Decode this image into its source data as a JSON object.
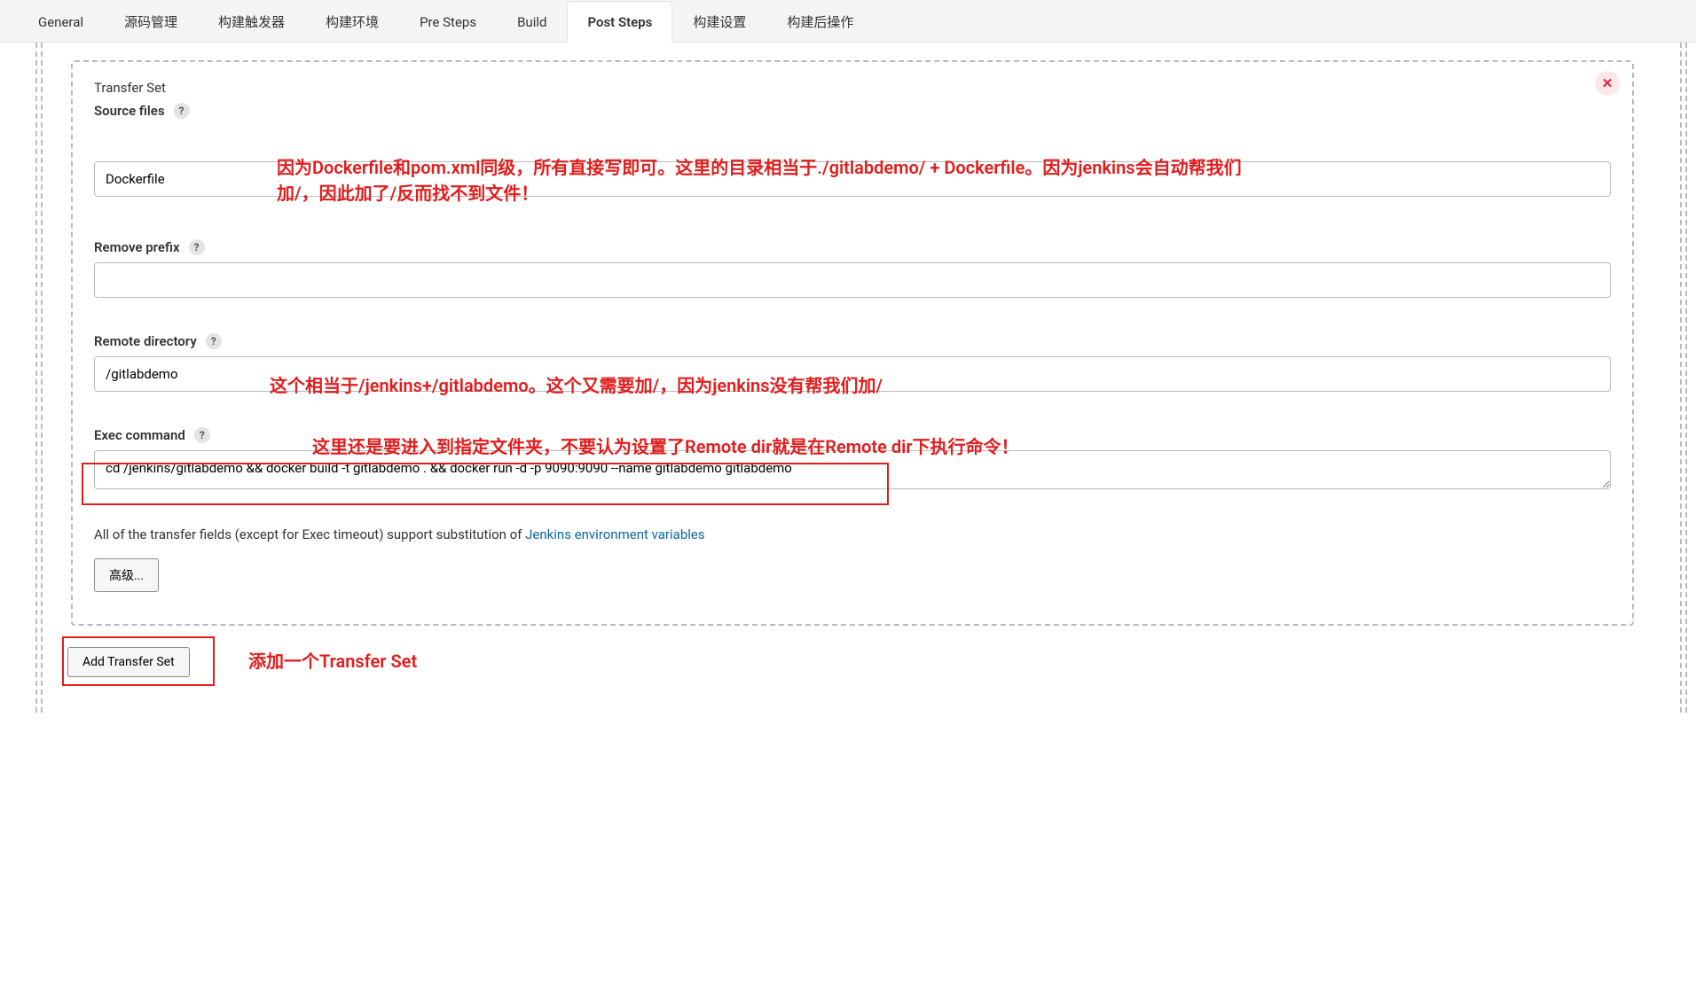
{
  "tabs": [
    {
      "label": "General"
    },
    {
      "label": "源码管理"
    },
    {
      "label": "构建触发器"
    },
    {
      "label": "构建环境"
    },
    {
      "label": "Pre Steps"
    },
    {
      "label": "Build"
    },
    {
      "label": "Post Steps"
    },
    {
      "label": "构建设置"
    },
    {
      "label": "构建后操作"
    }
  ],
  "active_tab_index": 6,
  "transfer_set": {
    "title": "Transfer Set",
    "close_icon": "✕",
    "fields": {
      "source_files": {
        "label": "Source files",
        "help": "?",
        "value": "Dockerfile"
      },
      "remove_prefix": {
        "label": "Remove prefix",
        "help": "?",
        "value": ""
      },
      "remote_directory": {
        "label": "Remote directory",
        "help": "?",
        "value": "/gitlabdemo"
      },
      "exec_command": {
        "label": "Exec command",
        "help": "?",
        "value": "cd /jenkins/gitlabdemo && docker build -t gitlabdemo . && docker run -d -p 9090:9090 --name gitlabdemo gitlabdemo"
      }
    },
    "note_prefix": "All of the transfer fields (except for Exec timeout) support substitution of ",
    "note_link": "Jenkins environment variables",
    "advanced_label": "高级..."
  },
  "add_transfer_label": "Add Transfer Set",
  "annotations": {
    "a1": "因为Dockerfile和pom.xml同级，所有直接写即可。这里的目录相当于./gitlabdemo/ + Dockerfile。因为jenkins会自动帮我们加/，因此加了/反而找不到文件！",
    "a2": "这个相当于/jenkins+/gitlabdemo。这个又需要加/，因为jenkins没有帮我们加/",
    "a3": "这里还是要进入到指定文件夹，不要认为设置了Remote dir就是在Remote dir下执行命令！",
    "a4": "添加一个Transfer Set"
  }
}
